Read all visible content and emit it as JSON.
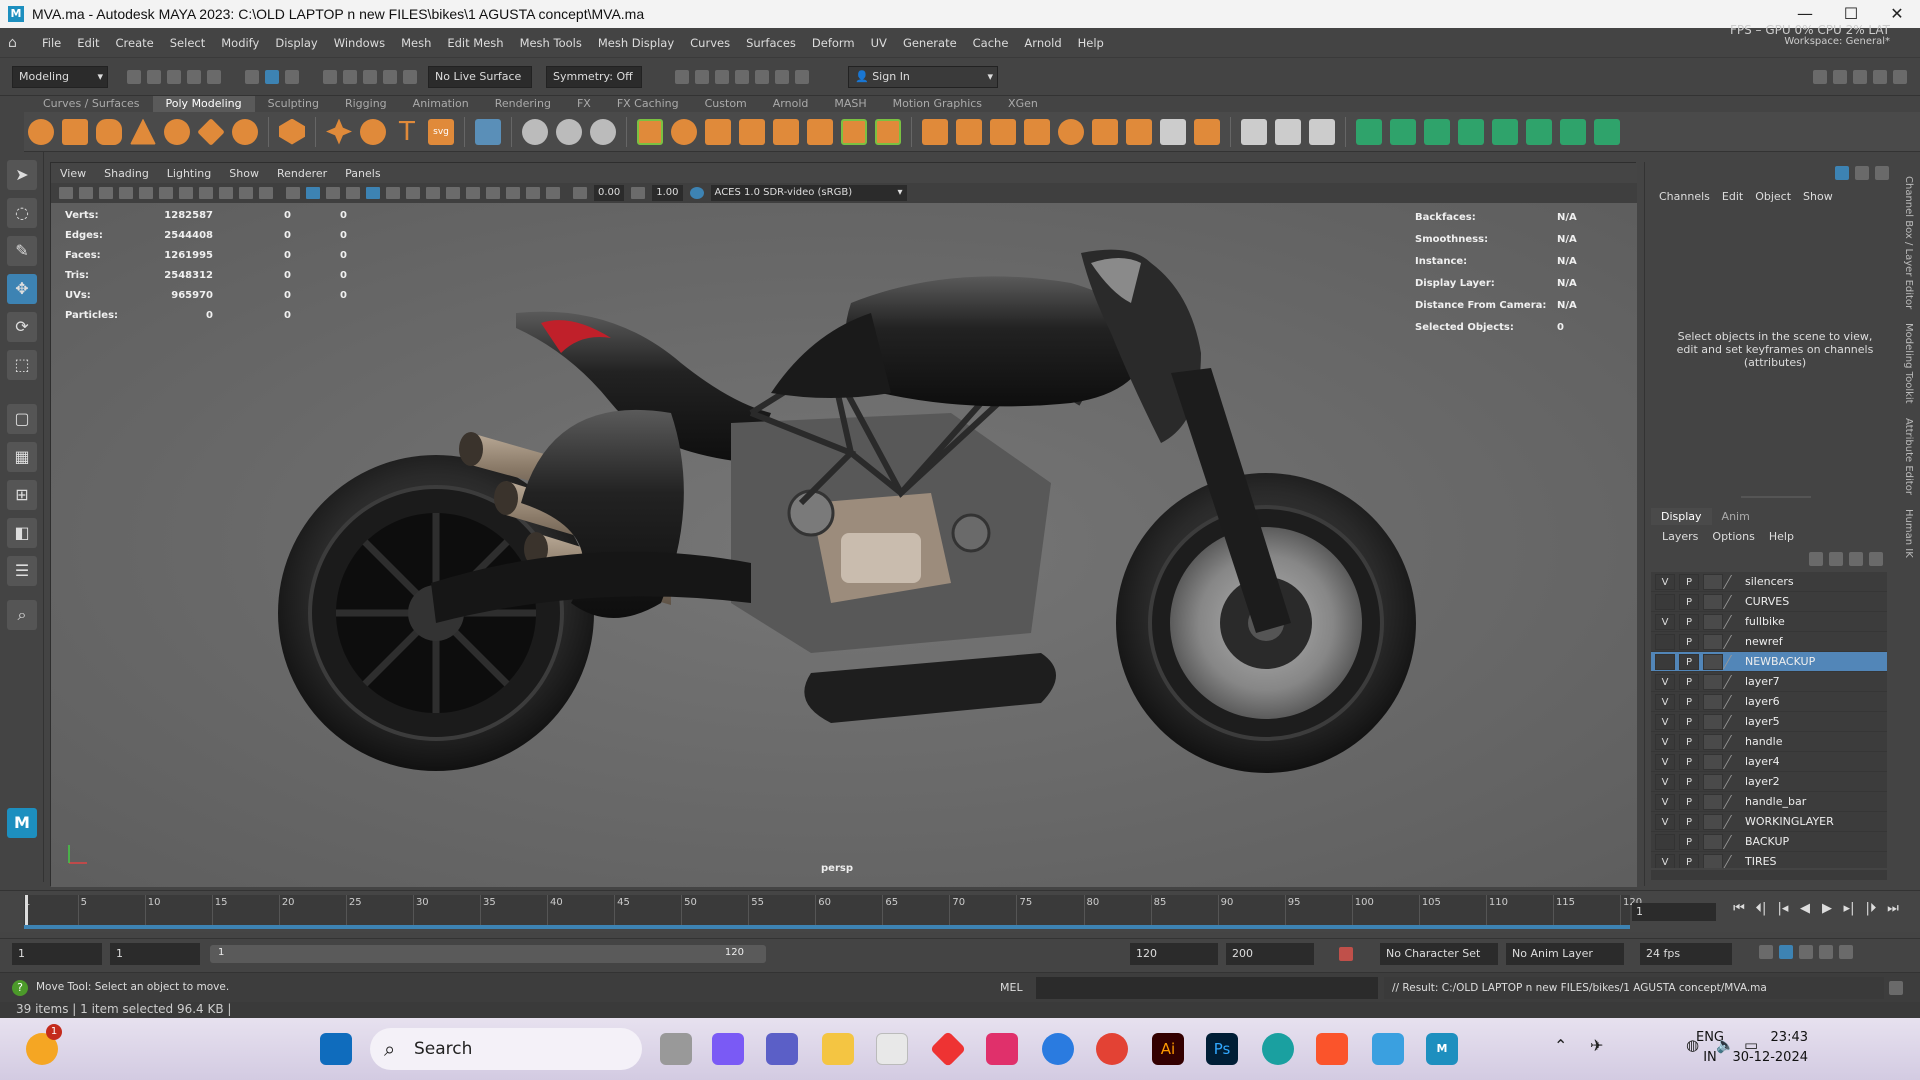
{
  "window": {
    "title": "MVA.ma - Autodesk MAYA 2023: C:\\OLD LAPTOP n new FILES\\bikes\\1 AGUSTA concept\\MVA.ma",
    "logo": "M"
  },
  "menu": [
    "File",
    "Edit",
    "Create",
    "Select",
    "Modify",
    "Display",
    "Windows",
    "Mesh",
    "Edit Mesh",
    "Mesh Tools",
    "Mesh Display",
    "Curves",
    "Surfaces",
    "Deform",
    "UV",
    "Generate",
    "Cache",
    "Arnold",
    "Help"
  ],
  "perf": {
    "line1": "FPS   –  GPU  0%  CPU   2%  LAT",
    "line2": "Workspace:  General*"
  },
  "statusline": {
    "mode": "Modeling",
    "live_surface": "No Live Surface",
    "symmetry": "Symmetry: Off",
    "sign_in": "Sign In"
  },
  "shelf_tabs": [
    "Curves / Surfaces",
    "Poly Modeling",
    "Sculpting",
    "Rigging",
    "Animation",
    "Rendering",
    "FX",
    "FX Caching",
    "Custom",
    "Arnold",
    "MASH",
    "Motion Graphics",
    "XGen"
  ],
  "shelf_active": "Poly Modeling",
  "viewport": {
    "menu": [
      "View",
      "Shading",
      "Lighting",
      "Show",
      "Renderer",
      "Panels"
    ],
    "near": "0.00",
    "far": "1.00",
    "colorspace": "ACES 1.0 SDR-video (sRGB)",
    "camera": "persp",
    "stats": [
      {
        "label": "Verts:",
        "v1": "1282587",
        "v2": "0",
        "v3": "0"
      },
      {
        "label": "Edges:",
        "v1": "2544408",
        "v2": "0",
        "v3": "0"
      },
      {
        "label": "Faces:",
        "v1": "1261995",
        "v2": "0",
        "v3": "0"
      },
      {
        "label": "Tris:",
        "v1": "2548312",
        "v2": "0",
        "v3": "0"
      },
      {
        "label": "UVs:",
        "v1": "965970",
        "v2": "0",
        "v3": "0"
      },
      {
        "label": "Particles:",
        "v1": "0",
        "v2": "0",
        "v3": ""
      }
    ],
    "info": [
      {
        "label": "Backfaces:",
        "value": "N/A"
      },
      {
        "label": "Smoothness:",
        "value": "N/A"
      },
      {
        "label": "Instance:",
        "value": "N/A"
      },
      {
        "label": "Display Layer:",
        "value": "N/A"
      },
      {
        "label": "Distance From Camera:",
        "value": "N/A"
      },
      {
        "label": "Selected Objects:",
        "value": "0"
      }
    ]
  },
  "channelbox": {
    "menu": [
      "Channels",
      "Edit",
      "Object",
      "Show"
    ],
    "message": "Select objects in the scene to view, edit and set keyframes on channels (attributes)"
  },
  "layereditor": {
    "tabs": [
      "Display",
      "Anim"
    ],
    "menu": [
      "Layers",
      "Options",
      "Help"
    ],
    "layers": [
      {
        "name": "silencers",
        "v": "V",
        "p": "P",
        "selected": false
      },
      {
        "name": "CURVES",
        "v": "",
        "p": "P",
        "selected": false
      },
      {
        "name": "fullbike",
        "v": "V",
        "p": "P",
        "selected": false
      },
      {
        "name": "newref",
        "v": "",
        "p": "P",
        "selected": false
      },
      {
        "name": "NEWBACKUP",
        "v": "",
        "p": "P",
        "selected": true
      },
      {
        "name": "layer7",
        "v": "V",
        "p": "P",
        "selected": false
      },
      {
        "name": "layer6",
        "v": "V",
        "p": "P",
        "selected": false
      },
      {
        "name": "layer5",
        "v": "V",
        "p": "P",
        "selected": false
      },
      {
        "name": "handle",
        "v": "V",
        "p": "P",
        "selected": false
      },
      {
        "name": "layer4",
        "v": "V",
        "p": "P",
        "selected": false
      },
      {
        "name": "layer2",
        "v": "V",
        "p": "P",
        "selected": false
      },
      {
        "name": "handle_bar",
        "v": "V",
        "p": "P",
        "selected": false
      },
      {
        "name": "WORKINGLAYER",
        "v": "V",
        "p": "P",
        "selected": false
      },
      {
        "name": "BACKUP",
        "v": "",
        "p": "P",
        "selected": false
      },
      {
        "name": "TIRES",
        "v": "V",
        "p": "P",
        "selected": false
      }
    ]
  },
  "sidetabs": [
    "Channel Box / Layer Editor",
    "Modeling Toolkit",
    "Attribute Editor",
    "Human IK"
  ],
  "timeline": {
    "ticks": [
      "5",
      "10",
      "15",
      "20",
      "25",
      "30",
      "35",
      "40",
      "45",
      "50",
      "55",
      "60",
      "65",
      "70",
      "75",
      "80",
      "85",
      "90",
      "95",
      "100",
      "105",
      "110",
      "115",
      "120"
    ],
    "start_tick": "1",
    "current_frame": "1"
  },
  "range": {
    "start": "1",
    "playback_start": "1",
    "range_start": "1",
    "range_end": "120",
    "playback_end": "120",
    "end": "200",
    "character_set": "No Character Set",
    "anim_layer": "No Anim Layer",
    "fps": "24 fps"
  },
  "cmdline": {
    "lang": "MEL",
    "result": "// Result: C:/OLD LAPTOP n new FILES/bikes/1 AGUSTA concept/MVA.ma",
    "help": "Move Tool: Select an object to move."
  },
  "explorer_status": "39 items  |  1 item selected  96.4 KB  |",
  "taskbar": {
    "search": "Search",
    "lang1": "ENG",
    "lang2": "IN",
    "time": "23:43",
    "date": "30-12-2024",
    "badge": "1"
  },
  "colors": {
    "accent": "#3d83b3",
    "selected_layer": "#5286b8",
    "viewport_bg": "#6d6d6d"
  }
}
